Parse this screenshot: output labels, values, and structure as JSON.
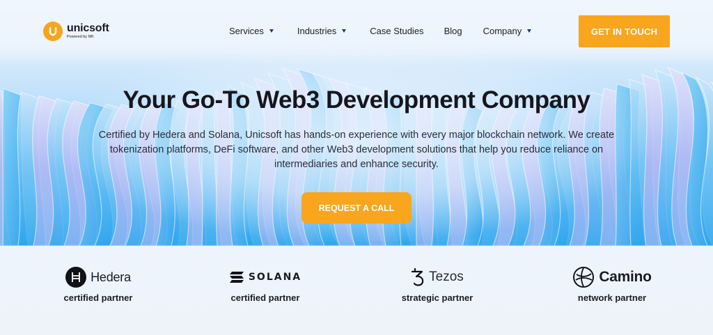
{
  "header": {
    "logo": {
      "name": "unicsoft",
      "tagline": "Powered by MK"
    },
    "nav": [
      {
        "label": "Services",
        "has_dropdown": true
      },
      {
        "label": "Industries",
        "has_dropdown": true
      },
      {
        "label": "Case Studies",
        "has_dropdown": false
      },
      {
        "label": "Blog",
        "has_dropdown": false
      },
      {
        "label": "Company",
        "has_dropdown": true
      }
    ],
    "cta_label": "GET IN TOUCH"
  },
  "hero": {
    "title": "Your Go-To Web3 Development Company",
    "description": "Certified by Hedera and Solana, Unicsoft has hands-on experience with every major blockchain network. We create tokenization platforms, DeFi software, and other Web3 development solutions that help you reduce reliance on intermediaries and enhance security.",
    "cta_label": "REQUEST A CALL"
  },
  "partners": [
    {
      "name": "Hedera",
      "label": "certified partner",
      "icon": "hedera-icon"
    },
    {
      "name": "SOLANA",
      "label": "certified partner",
      "icon": "solana-icon"
    },
    {
      "name": "Tezos",
      "label": "strategic partner",
      "icon": "tezos-icon"
    },
    {
      "name": "Camino",
      "label": "network partner",
      "icon": "camino-icon"
    }
  ],
  "colors": {
    "accent": "#f9a51e",
    "text": "#1b1b27",
    "hero_blue": "#79c6f5",
    "partners_bg": "#eef4fc"
  }
}
